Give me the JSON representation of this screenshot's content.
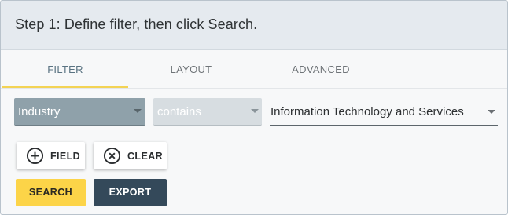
{
  "header": {
    "title": "Step 1: Define filter, then click Search."
  },
  "tabs": [
    {
      "label": "FILTER",
      "active": true
    },
    {
      "label": "LAYOUT",
      "active": false
    },
    {
      "label": "ADVANCED",
      "active": false
    }
  ],
  "filter": {
    "field": {
      "value": "Industry",
      "icon": "caret-down-icon"
    },
    "operator": {
      "value": "contains",
      "icon": "caret-down-icon"
    },
    "value": {
      "value": "Information Technology and Services",
      "icon": "caret-down-icon"
    }
  },
  "buttons": {
    "add_field": {
      "label": "FIELD",
      "icon": "plus-circle-icon"
    },
    "clear": {
      "label": "CLEAR",
      "icon": "x-circle-icon"
    },
    "search": {
      "label": "SEARCH"
    },
    "export": {
      "label": "EXPORT"
    }
  },
  "colors": {
    "accent": "#f3d354",
    "search_button": "#fcd448",
    "export_button": "#34495a",
    "field_select": "#8fa1aa"
  }
}
